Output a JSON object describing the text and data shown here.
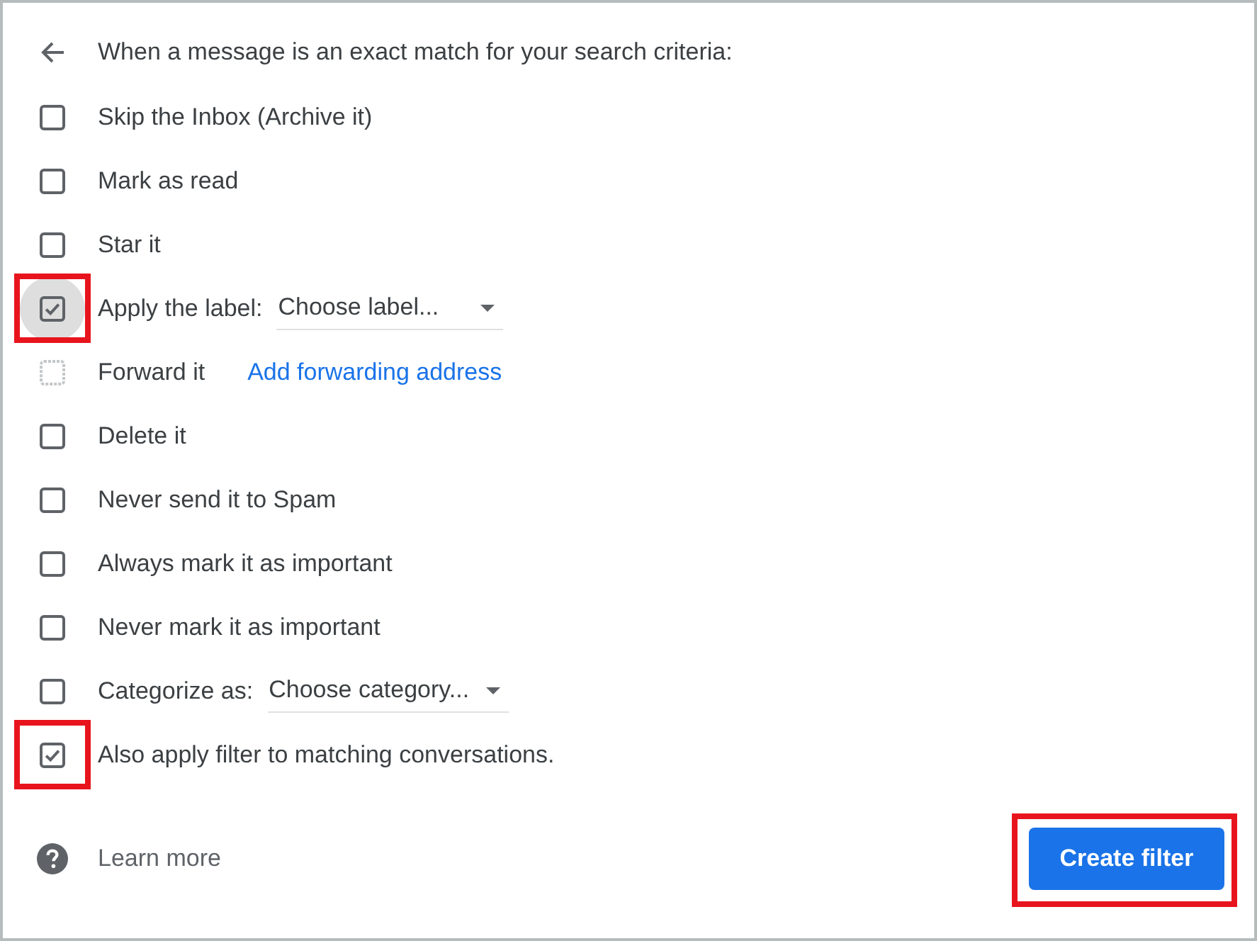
{
  "header": {
    "title": "When a message is an exact match for your search criteria:"
  },
  "options": [
    {
      "kind": "plain",
      "label": "Skip the Inbox (Archive it)",
      "checked": false,
      "disabled": false,
      "focused": false,
      "highlighted": false
    },
    {
      "kind": "plain",
      "label": "Mark as read",
      "checked": false,
      "disabled": false,
      "focused": false,
      "highlighted": false
    },
    {
      "kind": "plain",
      "label": "Star it",
      "checked": false,
      "disabled": false,
      "focused": false,
      "highlighted": false
    },
    {
      "kind": "dropdown",
      "label": "Apply the label:",
      "value": "Choose label...",
      "checked": true,
      "disabled": false,
      "focused": true,
      "highlighted": true
    },
    {
      "kind": "link",
      "label": "Forward it",
      "link": "Add forwarding address",
      "checked": false,
      "disabled": true,
      "focused": false,
      "highlighted": false
    },
    {
      "kind": "plain",
      "label": "Delete it",
      "checked": false,
      "disabled": false,
      "focused": false,
      "highlighted": false
    },
    {
      "kind": "plain",
      "label": "Never send it to Spam",
      "checked": false,
      "disabled": false,
      "focused": false,
      "highlighted": false
    },
    {
      "kind": "plain",
      "label": "Always mark it as important",
      "checked": false,
      "disabled": false,
      "focused": false,
      "highlighted": false
    },
    {
      "kind": "plain",
      "label": "Never mark it as important",
      "checked": false,
      "disabled": false,
      "focused": false,
      "highlighted": false
    },
    {
      "kind": "dropdown",
      "label": "Categorize as:",
      "value": "Choose category...",
      "checked": false,
      "disabled": false,
      "focused": false,
      "highlighted": false
    },
    {
      "kind": "plain",
      "label": "Also apply filter to matching conversations.",
      "checked": true,
      "disabled": false,
      "focused": false,
      "highlighted": true
    }
  ],
  "footer": {
    "help_link": "Learn more",
    "button": {
      "label": "Create filter",
      "highlighted": true
    }
  }
}
